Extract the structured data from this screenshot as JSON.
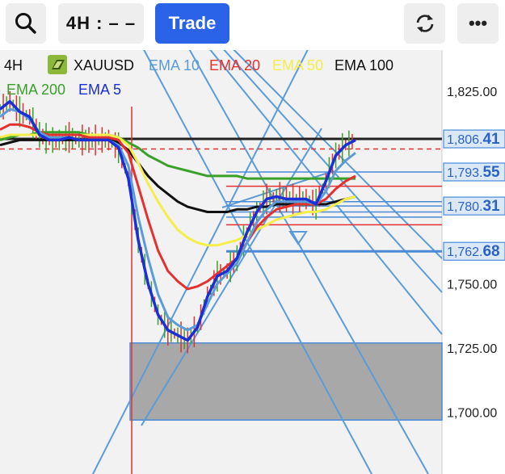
{
  "toolbar": {
    "search_icon": "search-icon",
    "timeframe_label": "4H : – –",
    "trade_label": "Trade",
    "refresh_icon": "refresh-icon",
    "more_label": "•••"
  },
  "chart_data": {
    "type": "line",
    "symbol": "XAUUSD",
    "timeframe": "4H",
    "legend": [
      "EMA 10",
      "EMA 20",
      "EMA 50",
      "EMA 100",
      "EMA 200",
      "EMA 5"
    ],
    "y_ticks": [
      "1,825.00",
      "1,750.00",
      "1,725.00",
      "1,700.00"
    ],
    "ylim": [
      1676,
      1841
    ],
    "price_tags": [
      "1,806.41",
      "1,793.55",
      "1,780.31",
      "1,762.68"
    ],
    "series": [
      {
        "name": "EMA 5",
        "color": "#1a2fd6",
        "values": [
          1818,
          1821,
          1817,
          1815,
          1808,
          1806,
          1806,
          1807,
          1806,
          1806,
          1806,
          1806,
          1803,
          1791,
          1767,
          1750,
          1738,
          1732,
          1730,
          1728,
          1733,
          1745,
          1753,
          1755,
          1760,
          1770,
          1778,
          1783,
          1784,
          1783,
          1783,
          1783,
          1781,
          1790,
          1800,
          1804,
          1806
        ]
      },
      {
        "name": "EMA 10",
        "color": "#5b9bd8",
        "values": [
          1815,
          1818,
          1817,
          1814,
          1809,
          1807,
          1807,
          1807,
          1806,
          1806,
          1806,
          1806,
          1804,
          1796,
          1776,
          1760,
          1746,
          1737,
          1734,
          1732,
          1734,
          1742,
          1750,
          1754,
          1758,
          1766,
          1774,
          1779,
          1782,
          1782,
          1782,
          1782,
          1781,
          1786,
          1794,
          1798,
          1801
        ]
      },
      {
        "name": "EMA 20",
        "color": "#e53030",
        "values": [
          1810,
          1812,
          1812,
          1811,
          1809,
          1808,
          1808,
          1808,
          1808,
          1807,
          1807,
          1807,
          1806,
          1801,
          1788,
          1775,
          1763,
          1755,
          1751,
          1748,
          1749,
          1751,
          1754,
          1757,
          1760,
          1766,
          1772,
          1776,
          1779,
          1780,
          1781,
          1781,
          1781,
          1783,
          1787,
          1790,
          1792
        ]
      },
      {
        "name": "EMA 50",
        "color": "#f5ee4a",
        "values": [
          1807,
          1808,
          1808,
          1808,
          1808,
          1808,
          1808,
          1808,
          1808,
          1808,
          1808,
          1808,
          1807,
          1804,
          1797,
          1789,
          1782,
          1776,
          1771,
          1768,
          1766,
          1765,
          1765,
          1766,
          1767,
          1769,
          1771,
          1773,
          1775,
          1776,
          1777,
          1778,
          1778,
          1779,
          1781,
          1783,
          1784
        ]
      },
      {
        "name": "EMA 100",
        "color": "#111111",
        "values": [
          1804,
          1805,
          1806,
          1806,
          1806,
          1806,
          1806,
          1806,
          1806,
          1806,
          1806,
          1806,
          1805,
          1802,
          1797,
          1792,
          1788,
          1785,
          1782,
          1780,
          1779,
          1778,
          1778,
          1778,
          1779,
          1779,
          1780,
          1780,
          1781,
          1781,
          1781,
          1781,
          1781,
          1781,
          1782,
          1783,
          1784
        ]
      },
      {
        "name": "EMA 200",
        "color": "#3aa02a",
        "values": [
          1806,
          1807,
          1808,
          1808,
          1809,
          1809,
          1809,
          1809,
          1809,
          1808,
          1808,
          1808,
          1807,
          1805,
          1803,
          1800,
          1798,
          1796,
          1795,
          1794,
          1793,
          1792,
          1792,
          1792,
          1792,
          1791,
          1791,
          1791,
          1791,
          1791,
          1791,
          1791,
          1791,
          1791,
          1791,
          1791,
          1791
        ]
      }
    ],
    "horizontal_levels": [
      {
        "value": 1806.41,
        "color": "#222222"
      },
      {
        "value": 1802.5,
        "color": "#e53030",
        "dashed": true
      },
      {
        "value": 1793.55,
        "color": "#4a8ad6"
      },
      {
        "value": 1788,
        "color": "#e53030"
      },
      {
        "value": 1782,
        "color": "#4a8ad6"
      },
      {
        "value": 1780.31,
        "color": "#4a8ad6"
      },
      {
        "value": 1778,
        "color": "#4a8ad6"
      },
      {
        "value": 1776,
        "color": "#4a8ad6"
      },
      {
        "value": 1773,
        "color": "#e53030"
      },
      {
        "value": 1762.68,
        "color": "#4a8ad6"
      }
    ],
    "demand_zone": {
      "top": 1727,
      "bottom": 1697
    }
  }
}
